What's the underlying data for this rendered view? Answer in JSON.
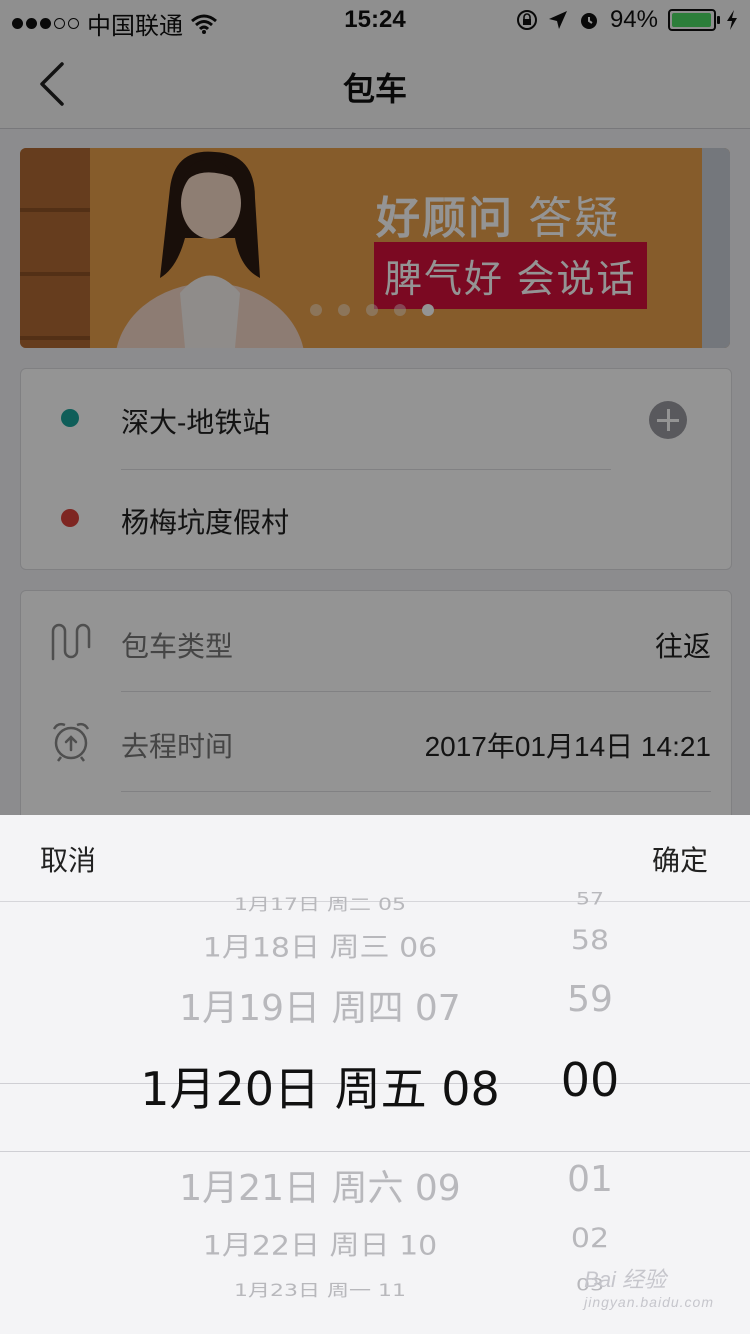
{
  "status_bar": {
    "carrier": "中国联通",
    "time": "15:24",
    "battery": "94%",
    "battery_level": 0.94,
    "icons": [
      "signal-dots-icon",
      "wifi-icon",
      "rotation-lock-icon",
      "location-arrow-icon",
      "alarm-icon",
      "battery-icon",
      "charging-bolt-icon"
    ]
  },
  "navbar": {
    "title": "包车",
    "back_icon": "chevron-left-icon"
  },
  "banner": {
    "headline_bold": "好顾问",
    "headline_light": "答疑",
    "tag": "脾气好 会说话",
    "slides": 5,
    "active_slide": 5
  },
  "locations": [
    {
      "name": "深大-地铁站",
      "dot_color": "#1aa39a"
    },
    {
      "name": "杨梅坑度假村",
      "dot_color": "#d9433b"
    }
  ],
  "options": [
    {
      "label": "包车类型",
      "value": "往返",
      "icon": "route-icon"
    },
    {
      "label": "去程时间",
      "value": "2017年01月14日 14:21",
      "icon": "alarm-clock-icon"
    }
  ],
  "sheet": {
    "cancel_label": "取消",
    "confirm_label": "确定",
    "date_items": [
      "1月17日 周二 05",
      "1月18日 周三 06",
      "1月19日 周四 07",
      "1月20日 周五 08",
      "1月21日 周六 09",
      "1月22日 周日 10",
      "1月23日 周一 11"
    ],
    "minute_items": [
      "57",
      "58",
      "59",
      "00",
      "01",
      "02",
      "03"
    ],
    "selected_index": 3
  },
  "watermark": {
    "brand": "Bai 经验",
    "url": "jingyan.baidu.com"
  },
  "colors": {
    "accent_green": "#4cd964",
    "tag_red": "#d4103b",
    "banner_orange": "#e79f4a"
  }
}
